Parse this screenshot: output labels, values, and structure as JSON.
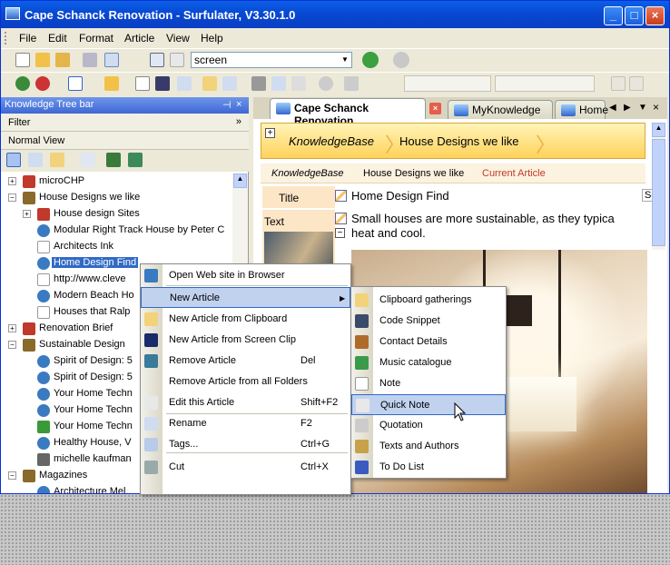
{
  "window": {
    "title": "Cape Schanck Renovation - Surfulater, V3.30.1.0",
    "controls": {
      "minimize": "_",
      "maximize": "□",
      "close": "×"
    }
  },
  "menubar": {
    "items": [
      "File",
      "Edit",
      "Format",
      "Article",
      "View",
      "Help"
    ]
  },
  "toolbar": {
    "combo_value": "screen"
  },
  "left_pane": {
    "header": "Knowledge Tree bar",
    "pin": "⊣",
    "close": "×",
    "filter_label": "Filter",
    "filter_toggle": "»",
    "view_label": "Normal View",
    "tree": [
      {
        "label": "microCHP",
        "indent": 0,
        "expander": "+",
        "icon": "book-icon"
      },
      {
        "label": "House Designs we like",
        "indent": 0,
        "expander": "−",
        "icon": "open-book-icon"
      },
      {
        "label": "House design Sites",
        "indent": 1,
        "expander": "+",
        "icon": "book-icon"
      },
      {
        "label": "Modular Right Track House by Peter C",
        "indent": 1,
        "expander": "",
        "icon": "globe-icon"
      },
      {
        "label": "Architects Ink",
        "indent": 1,
        "expander": "",
        "icon": "page-icon"
      },
      {
        "label": "Home Design Find",
        "indent": 1,
        "expander": "",
        "icon": "globe-icon",
        "selected": true
      },
      {
        "label": "http://www.cleve",
        "indent": 1,
        "expander": "",
        "icon": "page-icon"
      },
      {
        "label": "Modern Beach Ho",
        "indent": 1,
        "expander": "",
        "icon": "globe-icon"
      },
      {
        "label": "Houses that Ralp",
        "indent": 1,
        "expander": "",
        "icon": "page-icon"
      },
      {
        "label": "Renovation Brief",
        "indent": 0,
        "expander": "+",
        "icon": "book-icon"
      },
      {
        "label": "Sustainable Design",
        "indent": 0,
        "expander": "−",
        "icon": "open-book-icon"
      },
      {
        "label": "Spirit of Design: 5",
        "indent": 1,
        "expander": "",
        "icon": "globe-icon"
      },
      {
        "label": "Spirit of Design: 5",
        "indent": 1,
        "expander": "",
        "icon": "globe-icon"
      },
      {
        "label": "Your Home Techn",
        "indent": 1,
        "expander": "",
        "icon": "globe-icon"
      },
      {
        "label": "Your Home Techn",
        "indent": 1,
        "expander": "",
        "icon": "globe-icon"
      },
      {
        "label": "Your Home Techn",
        "indent": 1,
        "expander": "",
        "icon": "flag-icon"
      },
      {
        "label": "Healthy House, V",
        "indent": 1,
        "expander": "",
        "icon": "globe-icon"
      },
      {
        "label": "michelle kaufman",
        "indent": 1,
        "expander": "",
        "icon": "grid-icon"
      },
      {
        "label": "Magazines",
        "indent": 0,
        "expander": "−",
        "icon": "open-book-icon"
      },
      {
        "label": "Architecture Mel",
        "indent": 1,
        "expander": "",
        "icon": "globe-icon"
      }
    ]
  },
  "tabs": [
    {
      "label": "Cape Schanck Renovation",
      "active": true,
      "close": "×"
    },
    {
      "label": "MyKnowledge",
      "active": false
    },
    {
      "label": "Home",
      "active": false
    }
  ],
  "tab_controls": {
    "prev": "◀",
    "next": "▶",
    "list": "▼",
    "close": "×"
  },
  "breadcrumb_large": {
    "expander": "+",
    "root": "KnowledgeBase",
    "item": "House Designs we like"
  },
  "breadcrumb_small": {
    "root": "KnowledgeBase",
    "item": "House Designs we like",
    "current": "Current Article"
  },
  "article": {
    "title_label": "Title",
    "title_value": "Home Design Find",
    "text_label": "Text",
    "text_value_line1": "Small houses are more sustainable, as they typica",
    "text_value_line2": "heat and cool.",
    "scroll_fragment": "Sc"
  },
  "context_menu": {
    "items": [
      {
        "label": "Open Web site in Browser",
        "key": "",
        "icon": "globe-icon"
      },
      {
        "label": "New Article",
        "key": "",
        "icon": "",
        "highlighted": true,
        "submenu": "▶"
      },
      {
        "label": "New Article from Clipboard",
        "key": "",
        "icon": "clipboard-icon"
      },
      {
        "label": "New Article from Screen Clip",
        "key": "",
        "icon": "screen-clip-icon"
      },
      {
        "label": "Remove Article",
        "key": "Del",
        "icon": "remove-icon"
      },
      {
        "label": "Remove Article from all Folders",
        "key": "",
        "icon": ""
      },
      {
        "label": "Edit this Article",
        "key": "Shift+F2",
        "icon": "edit-icon"
      },
      {
        "label": "Rename",
        "key": "F2",
        "icon": "rename-icon"
      },
      {
        "label": "Tags...",
        "key": "Ctrl+G",
        "icon": "tag-icon"
      },
      {
        "label": "Cut",
        "key": "Ctrl+X",
        "icon": "scissors-icon"
      }
    ]
  },
  "submenu": {
    "items": [
      {
        "label": "Clipboard gatherings",
        "icon": "clipboard-icon"
      },
      {
        "label": "Code Snippet",
        "icon": "code-icon"
      },
      {
        "label": "Contact Details",
        "icon": "contact-icon"
      },
      {
        "label": "Music catalogue",
        "icon": "music-icon"
      },
      {
        "label": "Note",
        "icon": "note-icon"
      },
      {
        "label": "Quick Note",
        "icon": "quick-note-icon",
        "highlighted": true
      },
      {
        "label": "Quotation",
        "icon": "quote-icon"
      },
      {
        "label": "Texts and Authors",
        "icon": "book-icon"
      },
      {
        "label": "To Do List",
        "icon": "todo-icon"
      }
    ]
  }
}
